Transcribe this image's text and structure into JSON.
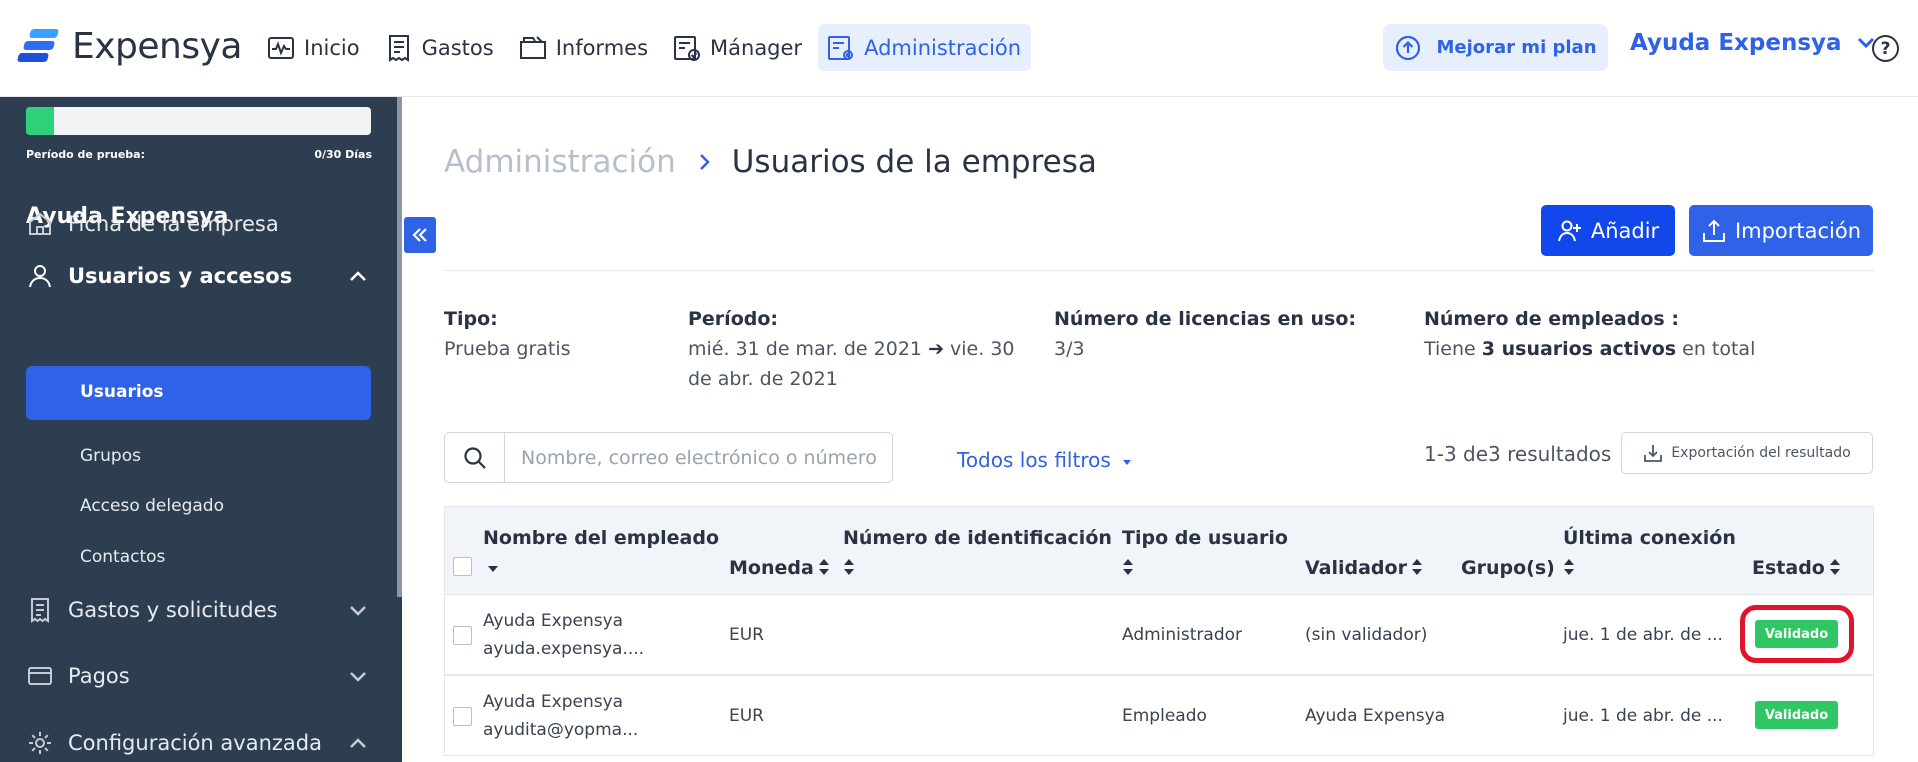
{
  "app": {
    "name": "Expensya"
  },
  "nav": [
    {
      "label": "Inicio",
      "icon": "pulse-icon",
      "active": false
    },
    {
      "label": "Gastos",
      "icon": "receipt-icon",
      "active": false
    },
    {
      "label": "Informes",
      "icon": "folder-icon",
      "active": false
    },
    {
      "label": "Mánager",
      "icon": "approval-icon",
      "active": false
    },
    {
      "label": "Administración",
      "icon": "admin-settings-icon",
      "active": true
    }
  ],
  "header": {
    "upgrade_label": "Mejorar mi plan",
    "account_label": "Ayuda Expensya",
    "help_label": "?"
  },
  "sidebar": {
    "trial_label": "Período de prueba:",
    "trial_days": "0/30 Días",
    "trial_progress": 0.08,
    "company": "Ayuda Expensya",
    "items": [
      {
        "label": "Ficha de la empresa"
      },
      {
        "label": "Usuarios y accesos"
      },
      {
        "label": "Gastos y solicitudes"
      },
      {
        "label": "Pagos"
      },
      {
        "label": "Configuración avanzada"
      }
    ],
    "subitems": [
      {
        "label": "Usuarios"
      },
      {
        "label": "Grupos"
      },
      {
        "label": "Acceso delegado"
      },
      {
        "label": "Contactos"
      }
    ]
  },
  "page": {
    "breadcrumb_parent": "Administración",
    "breadcrumb_current": "Usuarios de la empresa",
    "add_label": "Añadir",
    "import_label": "Importación"
  },
  "info": {
    "type_label": "Tipo:",
    "type_value": "Prueba gratis",
    "period_label": "Período:",
    "period_start": "mié. 31 de mar. de 2021",
    "period_end_line1": "vie. 30",
    "period_end_line2": "de abr. de 2021",
    "licenses_label": "Número de licencias en uso:",
    "licenses_value": "3/3",
    "employees_label": "Número de empleados :",
    "employees_prefix": "Tiene",
    "employees_bold": "3 usuarios activos",
    "employees_suffix": "en total"
  },
  "toolbar": {
    "search_placeholder": "Nombre, correo electrónico o número",
    "filters_label": "Todos los filtros",
    "results_text": "1-3 de3 resultados",
    "export_label": "Exportación del resultado"
  },
  "table": {
    "columns": {
      "name": "Nombre del empleado",
      "currency": "Moneda",
      "id_number": "Número de identificación",
      "user_type": "Tipo de usuario",
      "validator": "Validador",
      "groups": "Grupo(s)",
      "last_login": "Última conexión",
      "status": "Estado"
    },
    "rows": [
      {
        "name": "Ayuda Expensya",
        "email": "ayuda.expensya....",
        "currency": "EUR",
        "id_number": "",
        "user_type": "Administrador",
        "validator": "(sin validador)",
        "groups": "",
        "last_login": "jue. 1 de abr. de ...",
        "status": "Validado",
        "highlighted": true
      },
      {
        "name": "Ayuda Expensya",
        "email": "ayudita@yopma...",
        "currency": "EUR",
        "id_number": "",
        "user_type": "Empleado",
        "validator": "Ayuda Expensya",
        "groups": "",
        "last_login": "jue. 1 de abr. de ...",
        "status": "Validado",
        "highlighted": false
      }
    ]
  },
  "colors": {
    "brand_blue": "#2f62e6",
    "sidebar_bg": "#2d3e50",
    "status_green": "#2ec764",
    "highlight_red": "#e0152c"
  }
}
